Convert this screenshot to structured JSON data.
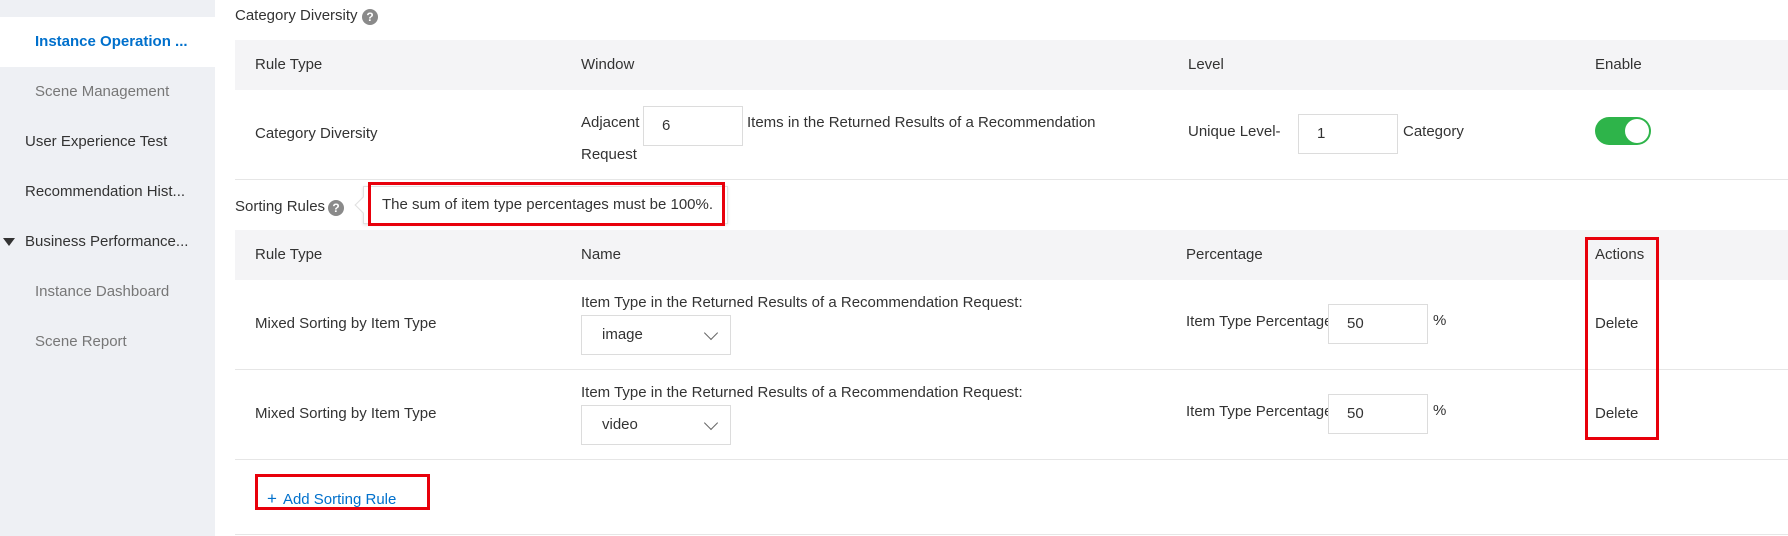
{
  "sidebar": {
    "items": [
      {
        "label": "Instance Operation ..."
      },
      {
        "label": "Scene Management"
      },
      {
        "label": "User Experience Test"
      },
      {
        "label": "Recommendation Hist..."
      },
      {
        "label": "Business Performance..."
      },
      {
        "label": "Instance Dashboard"
      },
      {
        "label": "Scene Report"
      }
    ]
  },
  "category_section": {
    "title": "Category Diversity",
    "help": "?",
    "headers": {
      "rule_type": "Rule Type",
      "window": "Window",
      "level": "Level",
      "enable": "Enable"
    },
    "row": {
      "rule_type": "Category Diversity",
      "window_prefix": "Adjacent",
      "window_value": "6",
      "window_suffix_1": "Items in the Returned Results of a Recommendation",
      "window_suffix_2": "Request",
      "level_prefix": "Unique Level-",
      "level_value": "1",
      "level_suffix": "Category",
      "enabled": true
    }
  },
  "sorting_section": {
    "title": "Sorting Rules",
    "help": "?",
    "tooltip": "The sum of item type percentages must be 100%.",
    "headers": {
      "rule_type": "Rule Type",
      "name": "Name",
      "percentage": "Percentage",
      "actions": "Actions"
    },
    "rows": [
      {
        "rule_type": "Mixed Sorting by Item Type",
        "name_label": "Item Type in the Returned Results of a Recommendation Request:",
        "item_type": "image",
        "pct_label": "Item Type Percentage",
        "pct_value": "50",
        "pct_unit": "%",
        "action": "Delete"
      },
      {
        "rule_type": "Mixed Sorting by Item Type",
        "name_label": "Item Type in the Returned Results of a Recommendation Request:",
        "item_type": "video",
        "pct_label": "Item Type Percentage",
        "pct_value": "50",
        "pct_unit": "%",
        "action": "Delete"
      }
    ],
    "add_icon": "+",
    "add_label": "Add Sorting Rule"
  },
  "colors": {
    "accent": "#0070cc",
    "toggle_on": "#2eb44a",
    "highlight": "#e8000b",
    "sidebar_bg": "#eef0f4",
    "header_bg": "#f4f4f6"
  }
}
